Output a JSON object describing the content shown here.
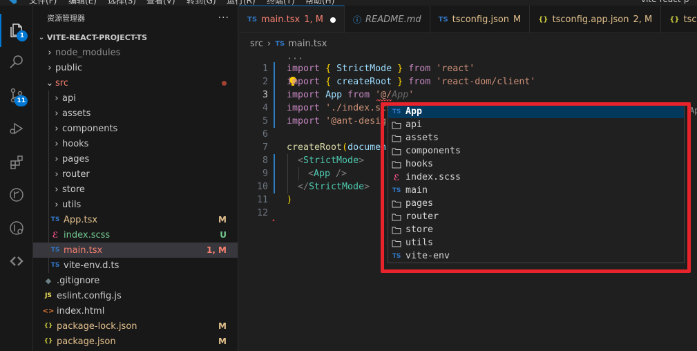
{
  "menubar": {
    "items": [
      "文件(F)",
      "编辑(E)",
      "选择(S)",
      "查看(V)",
      "转到(G)",
      "运行(R)",
      "终端(T)",
      "帮助(H)"
    ],
    "search_text": "vite-react-p"
  },
  "activity": {
    "explorer_badge": "1",
    "scm_badge": "11"
  },
  "sidebar": {
    "title": "资源管理器",
    "more": "···",
    "project": "VITE-REACT-PROJECT-TS",
    "tree": [
      {
        "label": "node_modules",
        "status": ""
      },
      {
        "label": "public",
        "status": ""
      },
      {
        "label": "src",
        "status": ""
      },
      {
        "label": "api",
        "status": ""
      },
      {
        "label": "assets",
        "status": ""
      },
      {
        "label": "components",
        "status": ""
      },
      {
        "label": "hooks",
        "status": ""
      },
      {
        "label": "pages",
        "status": ""
      },
      {
        "label": "router",
        "status": ""
      },
      {
        "label": "store",
        "status": ""
      },
      {
        "label": "utils",
        "status": ""
      },
      {
        "label": "App.tsx",
        "status": "M"
      },
      {
        "label": "index.scss",
        "status": "U"
      },
      {
        "label": "main.tsx",
        "status": "1, M"
      },
      {
        "label": "vite-env.d.ts",
        "status": ""
      },
      {
        "label": ".gitignore",
        "status": ""
      },
      {
        "label": "eslint.config.js",
        "status": ""
      },
      {
        "label": "index.html",
        "status": ""
      },
      {
        "label": "package-lock.json",
        "status": "M"
      },
      {
        "label": "package.json",
        "status": "M"
      }
    ]
  },
  "tabs": [
    {
      "icon": "TS",
      "label": "main.tsx",
      "mod": "1, M"
    },
    {
      "icon": "ⓘ",
      "label": "README.md",
      "mod": ""
    },
    {
      "icon": "TS",
      "label": "tsconfig.json",
      "mod": "M"
    },
    {
      "icon": "{}",
      "label": "tsconfig.app.json",
      "mod": "2, M"
    },
    {
      "icon": "{}",
      "label": "tscon",
      "mod": ""
    }
  ],
  "breadcrumb": {
    "folder": "src",
    "file_icon": "TS",
    "file": "main.tsx",
    "more": "···"
  },
  "editor": {
    "line_numbers": [
      "1",
      "2",
      "3",
      "4",
      "5",
      "6",
      "7",
      "8",
      "9",
      "10",
      "11",
      "12"
    ],
    "l1": {
      "kw": "import",
      "b1": "{",
      "id": "StrictMode",
      "b2": "}",
      "from": "from",
      "str": "'react'"
    },
    "l2": {
      "kw": "import",
      "b1": "{",
      "id": "createRoot",
      "b2": "}",
      "from": "from",
      "str": "'react-dom/client'"
    },
    "l3": {
      "kw": "import",
      "id": "App",
      "from": "from",
      "str": "'@/",
      "ghost": "App",
      "end": "'"
    },
    "l4": {
      "kw": "import",
      "str": "'./index.scs"
    },
    "l5": {
      "kw": "import",
      "str": "'@ant-desig"
    },
    "l7": {
      "fn": "createRoot",
      "p": "(",
      "id": "documen"
    },
    "l8": {
      "lt": "<",
      "tag": "StrictMode",
      "gt": ">"
    },
    "l9": {
      "lt": "<",
      "tag": "App",
      "gt": " />"
    },
    "l10": {
      "lt": "</",
      "tag": "StrictMode",
      "gt": ">"
    },
    "l11": {
      "p": ")"
    }
  },
  "suggest": {
    "items": [
      {
        "icon": "TS",
        "label": "App"
      },
      {
        "icon": "folder",
        "label": "api"
      },
      {
        "icon": "folder",
        "label": "assets"
      },
      {
        "icon": "folder",
        "label": "components"
      },
      {
        "icon": "folder",
        "label": "hooks"
      },
      {
        "icon": "scss",
        "label": "index.scss"
      },
      {
        "icon": "TS",
        "label": "main"
      },
      {
        "icon": "folder",
        "label": "pages"
      },
      {
        "icon": "folder",
        "label": "router"
      },
      {
        "icon": "folder",
        "label": "store"
      },
      {
        "icon": "folder",
        "label": "utils"
      },
      {
        "icon": "TS",
        "label": "vite-env"
      }
    ],
    "side_hint": "Ap"
  },
  "colors": {
    "accent": "#0078d4",
    "highlight": "#e8232b",
    "modified": "#e2c08d",
    "untracked": "#73c991",
    "error": "#f88070",
    "ts": "#3178c6"
  }
}
